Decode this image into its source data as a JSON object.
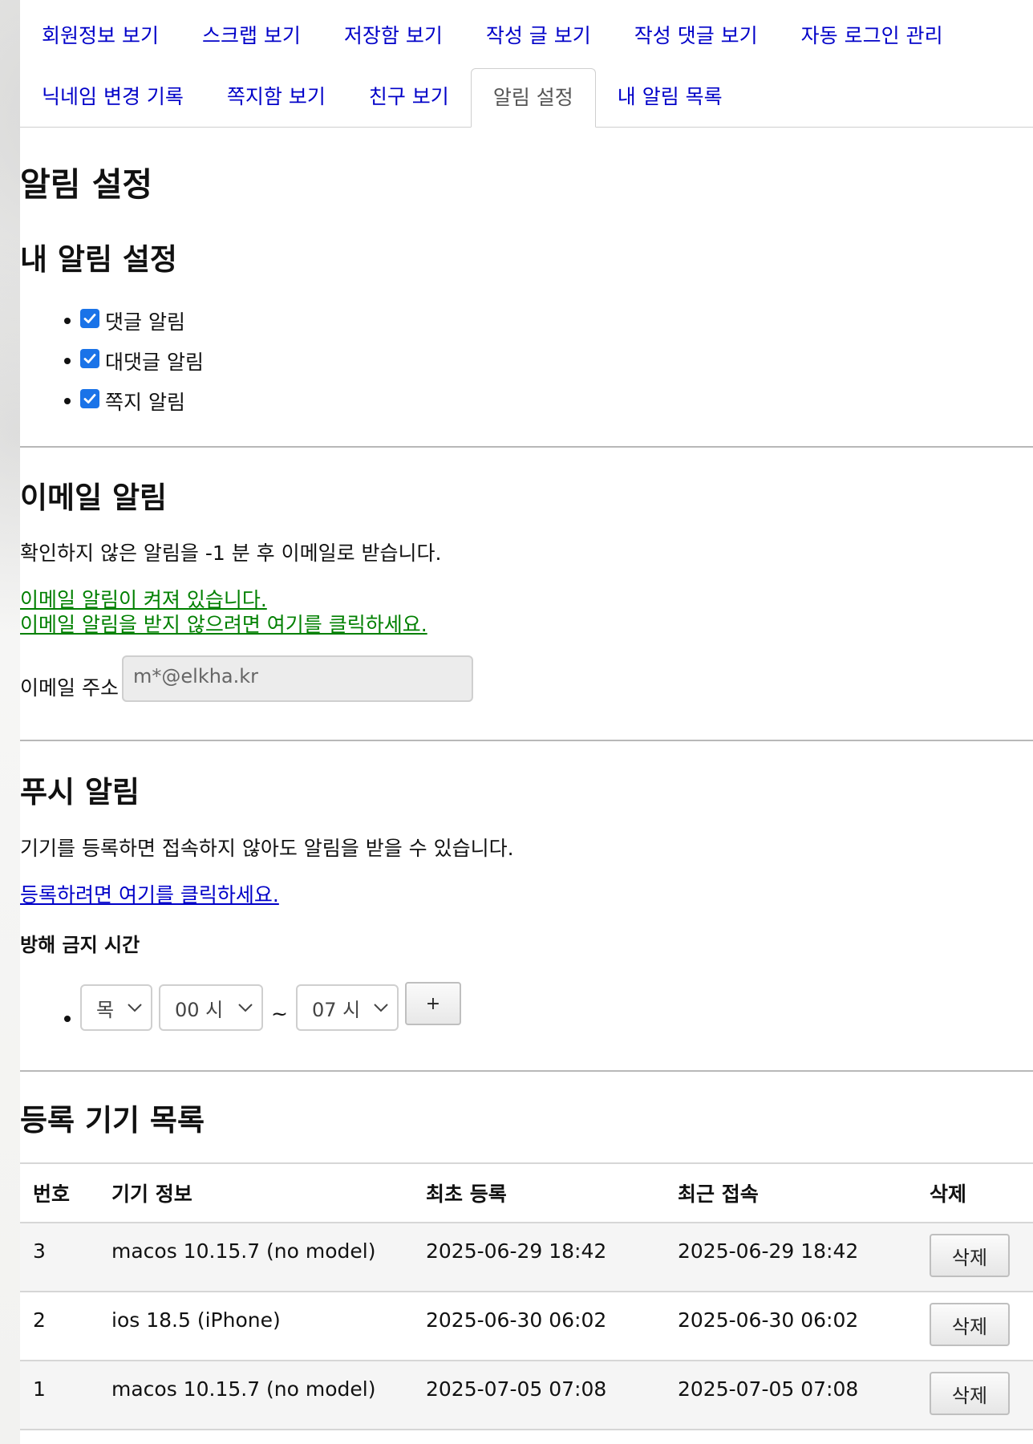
{
  "tabs": {
    "row1": [
      "회원정보 보기",
      "스크랩 보기",
      "저장함 보기",
      "작성 글 보기",
      "작성 댓글 보기",
      "자동 로그인 관리"
    ],
    "row2": [
      "닉네임 변경 기록",
      "쪽지함 보기",
      "친구 보기",
      "알림 설정",
      "내 알림 목록"
    ],
    "active": "알림 설정"
  },
  "page_title": "알림 설정",
  "my_notifications": {
    "heading": "내 알림 설정",
    "items": [
      {
        "label": "댓글 알림",
        "checked": true
      },
      {
        "label": "대댓글 알림",
        "checked": true
      },
      {
        "label": "쪽지 알림",
        "checked": true
      }
    ]
  },
  "email": {
    "heading": "이메일 알림",
    "description": "확인하지 않은 알림을 -1 분 후 이메일로 받습니다.",
    "status_line1": "이메일 알림이 켜져 있습니다.",
    "status_line2": "이메일 알림을 받지 않으려면 여기를 클릭하세요.",
    "address_label": "이메일 주소",
    "address_value": "m*@elkha.kr"
  },
  "push": {
    "heading": "푸시 알림",
    "description": "기기를 등록하면 접속하지 않아도 알림을 받을 수 있습니다.",
    "register_link": "등록하려면 여기를 클릭하세요.",
    "dnd_label": "방해 금지 시간",
    "dnd": {
      "day": "목",
      "start": "00 시",
      "separator": "~",
      "end": "07 시",
      "add_label": "+"
    }
  },
  "devices": {
    "heading": "등록 기기 목록",
    "columns": [
      "번호",
      "기기 정보",
      "최초 등록",
      "최근 접속",
      "삭제"
    ],
    "rows": [
      {
        "num": "3",
        "info": "macos 10.15.7 (no model)",
        "first": "2025-06-29 18:42",
        "last": "2025-06-29 18:42",
        "delete_label": "삭제"
      },
      {
        "num": "2",
        "info": "ios 18.5 (iPhone)",
        "first": "2025-06-30 06:02",
        "last": "2025-06-30 06:02",
        "delete_label": "삭제"
      },
      {
        "num": "1",
        "info": "macos 10.15.7 (no model)",
        "first": "2025-07-05 07:08",
        "last": "2025-07-05 07:08",
        "delete_label": "삭제"
      }
    ]
  },
  "colors": {
    "link": "#0000c8",
    "email_status": "#008000",
    "checkbox": "#1a73e8"
  }
}
